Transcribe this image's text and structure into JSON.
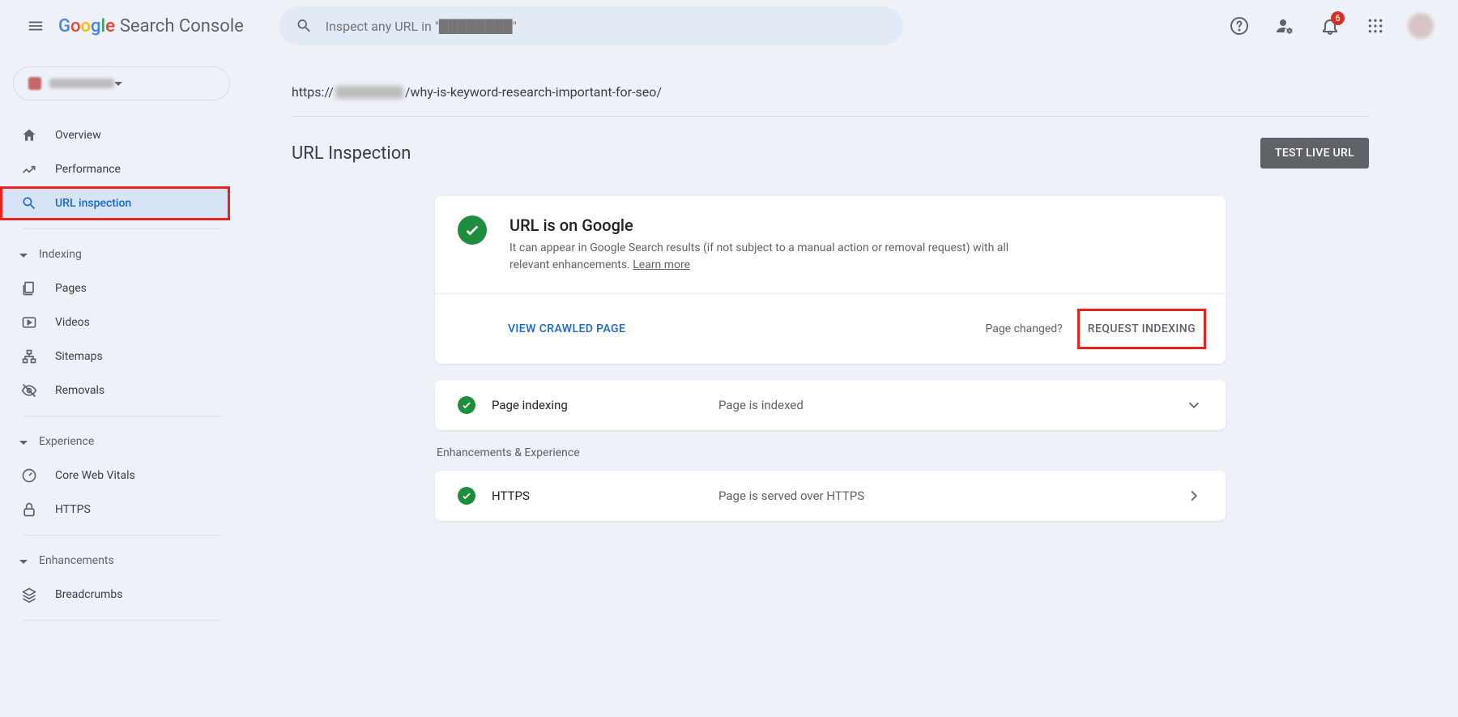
{
  "header": {
    "product_name": "Search Console",
    "search_placeholder": "Inspect any URL in \"████████\"",
    "notification_count": "6"
  },
  "sidebar": {
    "items_top": [
      {
        "label": "Overview"
      },
      {
        "label": "Performance"
      },
      {
        "label": "URL inspection"
      }
    ],
    "sections": {
      "indexing": {
        "title": "Indexing",
        "items": [
          {
            "label": "Pages"
          },
          {
            "label": "Videos"
          },
          {
            "label": "Sitemaps"
          },
          {
            "label": "Removals"
          }
        ]
      },
      "experience": {
        "title": "Experience",
        "items": [
          {
            "label": "Core Web Vitals"
          },
          {
            "label": "HTTPS"
          }
        ]
      },
      "enhancements": {
        "title": "Enhancements",
        "items": [
          {
            "label": "Breadcrumbs"
          }
        ]
      }
    }
  },
  "main": {
    "url_prefix": "https://",
    "url_suffix": "/why-is-keyword-research-important-for-seo/",
    "page_title": "URL Inspection",
    "test_live_btn": "TEST LIVE URL",
    "status": {
      "title": "URL is on Google",
      "description": "It can appear in Google Search results (if not subject to a manual action or removal request) with all relevant enhancements. ",
      "learn_more": "Learn more",
      "view_crawled": "VIEW CRAWLED PAGE",
      "page_changed": "Page changed?",
      "request_indexing": "REQUEST INDEXING"
    },
    "indexing_row": {
      "label": "Page indexing",
      "value": "Page is indexed"
    },
    "enhancements_heading": "Enhancements & Experience",
    "https_row": {
      "label": "HTTPS",
      "value": "Page is served over HTTPS"
    }
  }
}
